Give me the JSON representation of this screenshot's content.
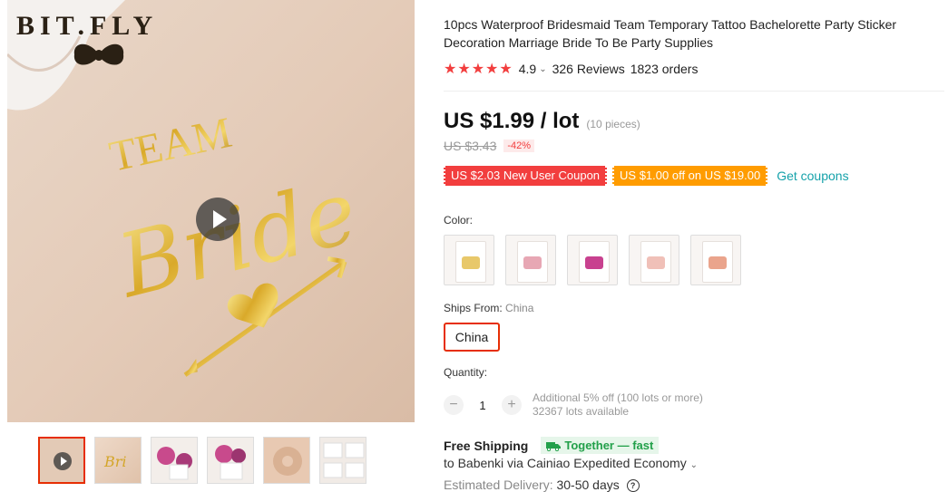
{
  "gallery": {
    "brand": "BIT.FLY",
    "tattoo_line1": "TEAM",
    "tattoo_line2": "Bride"
  },
  "product": {
    "title": "10pcs Waterproof Bridesmaid Team Temporary Tattoo Bachelorette Party Sticker Decoration Marriage Bride To Be Party Supplies"
  },
  "rating": {
    "stars": "★★★★★",
    "score": "4.9",
    "reviews": "326 Reviews",
    "orders": "1823 orders"
  },
  "price": {
    "current": "US $1.99 / lot",
    "pieces": "(10 pieces)",
    "old": "US $3.43",
    "discount": "-42%"
  },
  "coupons": {
    "new_user": "US $2.03 New User Coupon",
    "store": "US $1.00 off on US $19.00",
    "get": "Get coupons"
  },
  "color": {
    "label": "Color:",
    "swatches": [
      "#e8c86a",
      "#e7a7b4",
      "#c8418f",
      "#f0c0b8",
      "#eaa48c"
    ]
  },
  "ships_from": {
    "label": "Ships From:",
    "value": "China",
    "option": "China"
  },
  "quantity": {
    "label": "Quantity:",
    "minus": "−",
    "plus": "+",
    "value": "1",
    "additional": "Additional 5% off (100 lots or more)",
    "available": "32367 lots available"
  },
  "shipping": {
    "free": "Free Shipping",
    "badge": "Together — fast",
    "destination": "to Babenki via Cainiao Expedited Economy",
    "delivery_label": "Estimated Delivery:",
    "delivery_value": "30-50 days"
  },
  "colors": {
    "accent_red": "#f23e3e",
    "coupon_orange": "#ff9c00",
    "link_teal": "#16a2aa",
    "selected_border": "#e62e04",
    "badge_green": "#22a04a"
  }
}
